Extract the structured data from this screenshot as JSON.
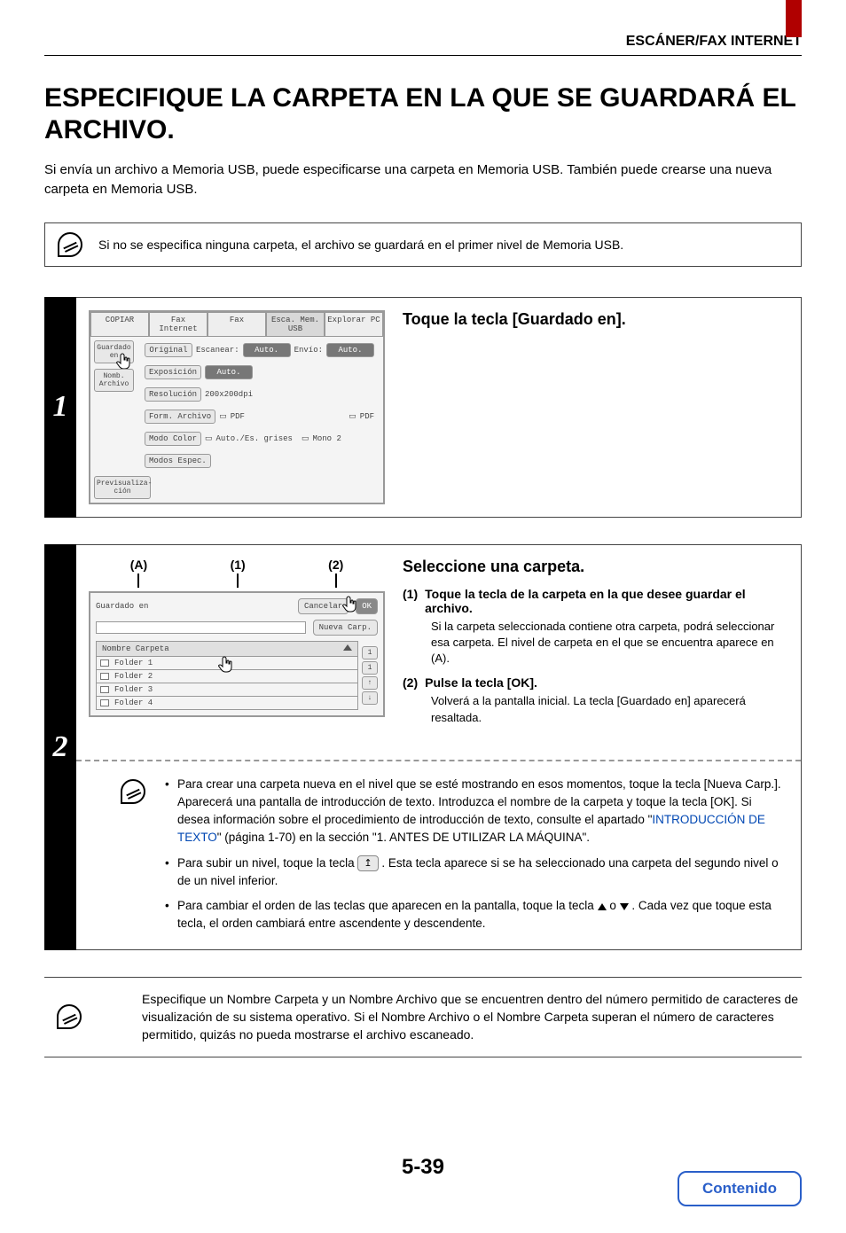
{
  "header": {
    "running": "ESCÁNER/FAX INTERNET"
  },
  "title": "ESPECIFIQUE LA CARPETA EN LA QUE SE GUARDARÁ EL ARCHIVO.",
  "lead": "Si envía un archivo a Memoria USB, puede especificarse una carpeta en Memoria USB. También puede crearse una nueva carpeta en Memoria USB.",
  "top_note": "Si no se especifica ninguna carpeta, el archivo se guardará en el primer nivel de Memoria USB.",
  "steps": {
    "s1": {
      "num": "1",
      "title": "Toque la tecla [Guardado en].",
      "panel": {
        "tabs": [
          "COPIAR",
          "Fax Internet",
          "Fax",
          "Esca. Mem. USB",
          "Explorar PC"
        ],
        "left_buttons": [
          "Guardado en",
          "Nomb. Archivo",
          "Previsualiza-\nción"
        ],
        "rows": [
          {
            "label": "Original",
            "k": "Escanear:",
            "v": "Auto.",
            "k2": "Envío:",
            "v2": "Auto."
          },
          {
            "label": "Exposición",
            "v": "Auto."
          },
          {
            "label": "Resolución",
            "v": "200x200dpi"
          },
          {
            "label": "Form. Archivo",
            "v": "PDF",
            "v2": "PDF"
          },
          {
            "label": "Modo Color",
            "v": "Auto./Es. grises",
            "v2": "Mono 2"
          },
          {
            "label": "Modos Espec."
          }
        ]
      }
    },
    "s2": {
      "num": "2",
      "title": "Seleccione una carpeta.",
      "callouts": {
        "A": "(A)",
        "one": "(1)",
        "two": "(2)"
      },
      "sub1_head": "Toque la tecla de la carpeta en la que desee guardar el archivo.",
      "sub1_text": "Si la carpeta seleccionada contiene otra carpeta, podrá seleccionar esa carpeta. El nivel de carpeta en el que se encuentra aparece en (A).",
      "sub1_num": "(1)",
      "sub2_num": "(2)",
      "sub2_head": "Pulse la tecla [OK].",
      "sub2_text": "Volverá a la pantalla inicial. La tecla [Guardado en] aparecerá resaltada.",
      "panel": {
        "saved_in": "Guardado en",
        "cancel": "Cancelar",
        "ok": "OK",
        "new_folder": "Nueva Carp.",
        "list_header": "Nombre Carpeta",
        "folders": [
          "Folder 1",
          "Folder 2",
          "Folder 3",
          "Folder 4"
        ],
        "scroll": [
          "1",
          "1",
          "↑",
          "↓"
        ]
      },
      "notes": {
        "n1a": "Para crear una carpeta nueva en el nivel que se esté mostrando en esos momentos, toque la tecla [Nueva Carp.]. Aparecerá una pantalla de introducción de texto. Introduzca el nombre de la carpeta y toque la tecla [OK]. Si desea información sobre el procedimiento de introducción de texto, consulte el apartado \"",
        "n1_link": "INTRODUCCIÓN DE TEXTO",
        "n1b": "\" (página 1-70) en la sección \"1. ANTES DE UTILIZAR LA MÁQUINA\".",
        "n2a": "Para subir un nivel, toque la tecla ",
        "n2b": " . Esta tecla aparece si se ha seleccionado una carpeta del segundo nivel o de un nivel inferior.",
        "n3a": "Para cambiar el orden de las teclas que aparecen en la pantalla, toque la tecla ",
        "n3b": " o ",
        "n3c": " . Cada vez que toque esta tecla, el orden cambiará entre ascendente y descendente."
      }
    }
  },
  "bottom_note": "Especifique un Nombre Carpeta y un Nombre Archivo que se encuentren dentro del número permitido de caracteres de visualización de su sistema operativo. Si el Nombre Archivo o el Nombre Carpeta superan el número de caracteres permitido, quizás no pueda mostrarse el archivo escaneado.",
  "page_number": "5-39",
  "contents_button": "Contenido",
  "up_level_icon_label": "↥"
}
